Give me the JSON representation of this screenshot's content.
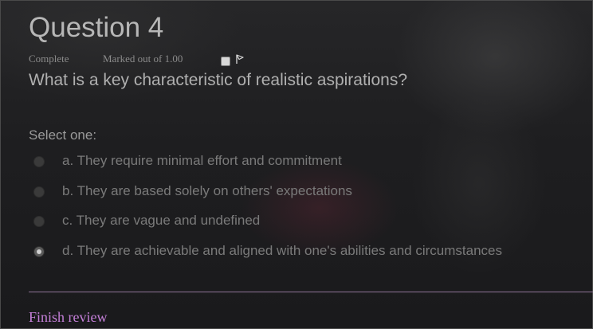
{
  "question": {
    "title": "Question 4",
    "status": "Complete",
    "marks": "Marked out of 1.00",
    "flag_icon": "flag-icon",
    "text": "What is a key characteristic of realistic aspirations?",
    "prompt": "Select one:",
    "options": [
      {
        "label": "a. They require minimal effort and commitment",
        "selected": false
      },
      {
        "label": "b. They are based solely on others' expectations",
        "selected": false
      },
      {
        "label": "c. They are vague and undefined",
        "selected": false
      },
      {
        "label": "d. They are achievable and aligned with one's abilities and circumstances",
        "selected": true
      }
    ]
  },
  "footer": {
    "finish_label": "Finish review"
  },
  "colors": {
    "accent": "#c47fd8",
    "divider": "#8e7396"
  }
}
